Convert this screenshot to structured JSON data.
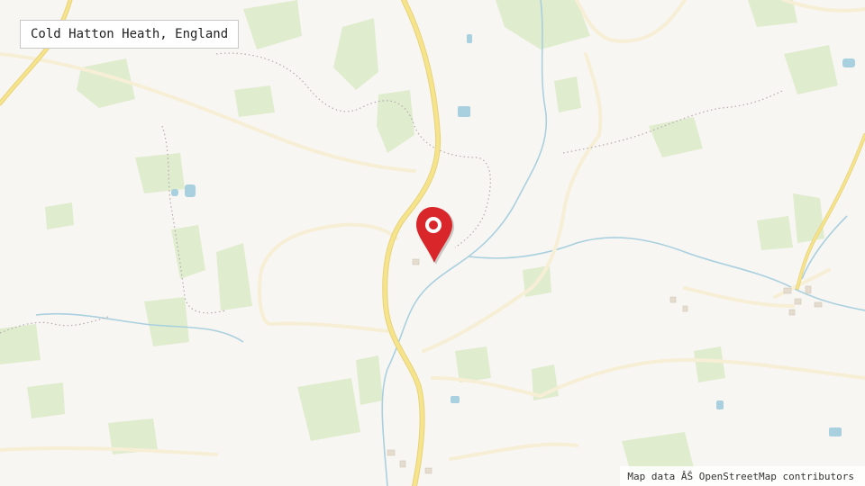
{
  "place": {
    "name": "Cold Hatton Heath, England"
  },
  "attribution": {
    "text": "Map data ÂŠ OpenStreetMap contributors"
  },
  "colors": {
    "background": "#f8f6f2",
    "woodland": "#dfeccd",
    "major_road": "#f5e48c",
    "minor_road": "#f7eed6",
    "water": "#a9d0df",
    "boundary": "#b7a8b0",
    "marker": "#d9262a"
  },
  "marker": {
    "icon": "map-pin-icon"
  }
}
